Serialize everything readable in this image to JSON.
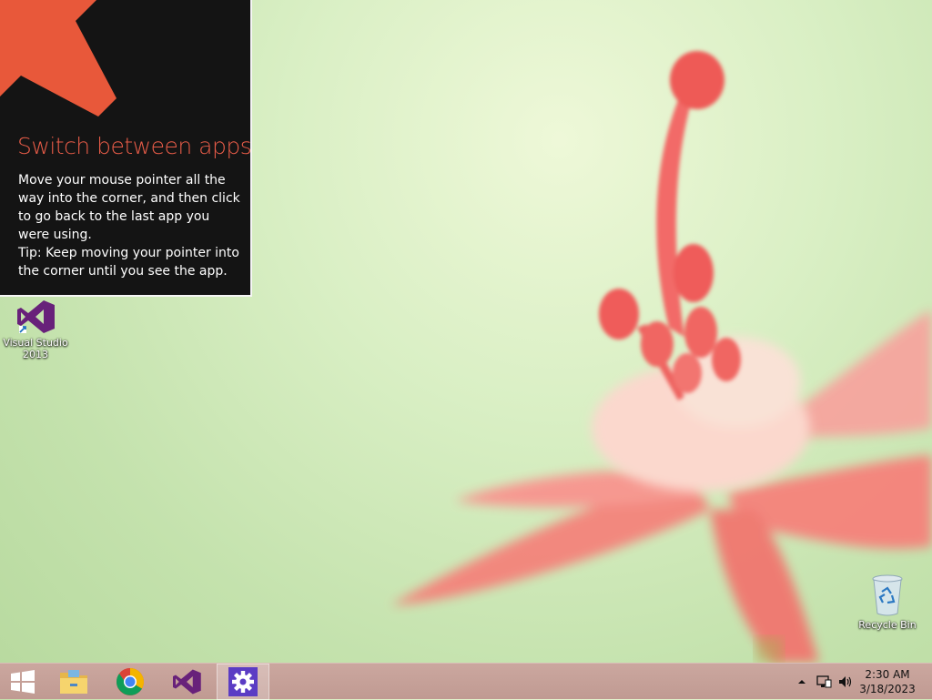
{
  "tip": {
    "title": "Switch between apps",
    "paragraph1": "Move your mouse pointer all the way into the corner, and then click to go back to the last app you were using.",
    "paragraph2": "Tip: Keep moving your pointer into the corner until you see the app.",
    "accent_color": "#e85c48"
  },
  "desktop_icons": [
    {
      "label_line1": "Visual Studio",
      "label_line2": "2013",
      "icon": "visual-studio-icon"
    },
    {
      "label": "Recycle Bin",
      "icon": "recycle-bin-icon"
    }
  ],
  "taskbar": {
    "buttons": [
      {
        "name": "start",
        "icon": "windows-logo-icon"
      },
      {
        "name": "file-explorer",
        "icon": "folder-icon"
      },
      {
        "name": "chrome",
        "icon": "chrome-icon"
      },
      {
        "name": "visual-studio",
        "icon": "visual-studio-icon"
      },
      {
        "name": "settings",
        "icon": "gear-icon",
        "active": true
      }
    ],
    "clock": {
      "time": "2:30 AM",
      "date": "3/18/2023"
    }
  }
}
